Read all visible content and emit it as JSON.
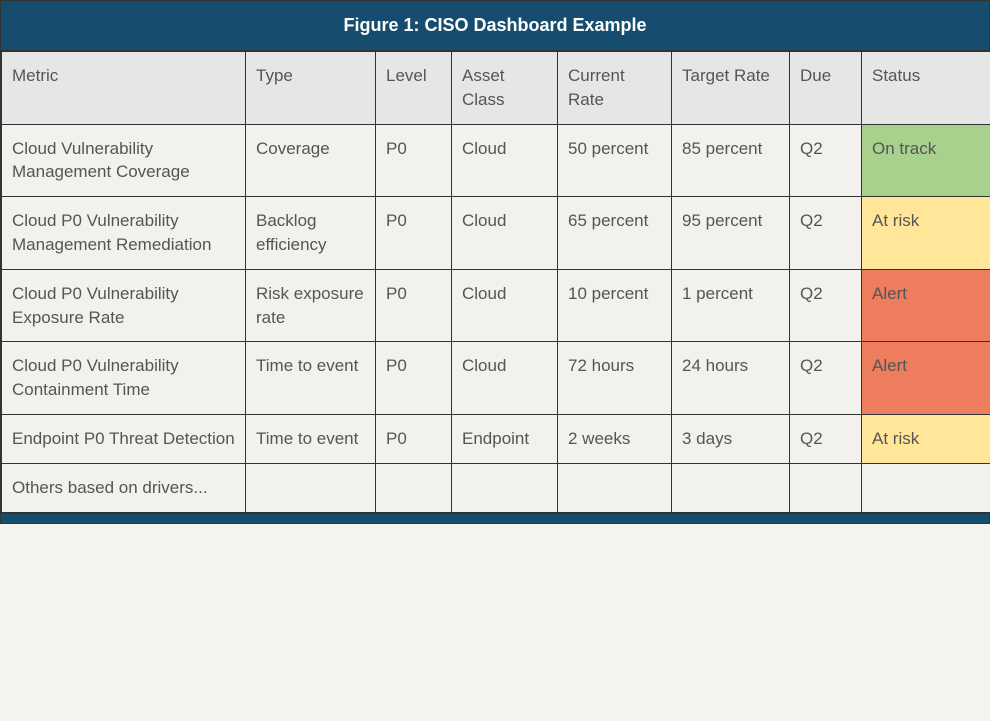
{
  "title": "Figure 1: CISO Dashboard Example",
  "columns": {
    "metric": "Metric",
    "type": "Type",
    "level": "Level",
    "asset_class": "Asset Class",
    "current_rate": "Current Rate",
    "target_rate": "Target Rate",
    "due": "Due",
    "status": "Status"
  },
  "rows": [
    {
      "metric": "Cloud Vulnerability Management Coverage",
      "type": "Coverage",
      "level": "P0",
      "asset_class": "Cloud",
      "current_rate": "50 percent",
      "target_rate": "85 percent",
      "due": "Q2",
      "status": "On track",
      "status_class": "ontrack"
    },
    {
      "metric": "Cloud P0 Vulnerability Management Remediation",
      "type": "Backlog efficiency",
      "level": "P0",
      "asset_class": "Cloud",
      "current_rate": "65 percent",
      "target_rate": "95 percent",
      "due": "Q2",
      "status": "At risk",
      "status_class": "atrisk"
    },
    {
      "metric": "Cloud P0 Vulnerability Exposure Rate",
      "type": "Risk exposure rate",
      "level": "P0",
      "asset_class": "Cloud",
      "current_rate": "10 percent",
      "target_rate": "1 percent",
      "due": "Q2",
      "status": "Alert",
      "status_class": "alert"
    },
    {
      "metric": "Cloud P0 Vulnerability Containment Time",
      "type": "Time to event",
      "level": "P0",
      "asset_class": "Cloud",
      "current_rate": "72 hours",
      "target_rate": "24 hours",
      "due": "Q2",
      "status": "Alert",
      "status_class": "alert"
    },
    {
      "metric": "Endpoint P0 Threat Detection",
      "type": "Time to event",
      "level": "P0",
      "asset_class": "Endpoint",
      "current_rate": "2 weeks",
      "target_rate": "3 days",
      "due": "Q2",
      "status": "At risk",
      "status_class": "atrisk"
    },
    {
      "metric": "Others based on drivers...",
      "type": "",
      "level": "",
      "asset_class": "",
      "current_rate": "",
      "target_rate": "",
      "due": "",
      "status": "",
      "status_class": ""
    }
  ]
}
